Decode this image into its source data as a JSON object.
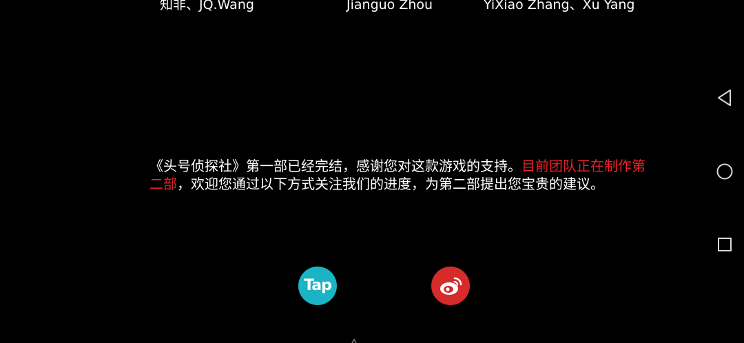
{
  "credits": [
    "知非、JQ.Wang",
    "Jianguo Zhou",
    "YiXiao Zhang、Xu Yang"
  ],
  "message": {
    "part1": "《头号侦探社》第一部已经完结，感谢您对这款游戏的支持。",
    "highlight": "目前团队正在制作第二部",
    "part2": "，欢迎您通过以下方式关注我们的进度，为第二部提出您宝贵的建议。"
  },
  "follow": {
    "taptap_label": "Tap",
    "taptap_icon": "taptap-icon",
    "weibo_icon": "weibo-icon"
  },
  "nav": {
    "back_icon": "triangle-back-icon",
    "home_icon": "circle-home-icon",
    "recent_icon": "square-recent-icon"
  },
  "colors": {
    "background": "#000000",
    "text": "#ffffff",
    "highlight": "#e8222a",
    "taptap": "#1bb3c6",
    "weibo": "#d52b2b"
  }
}
